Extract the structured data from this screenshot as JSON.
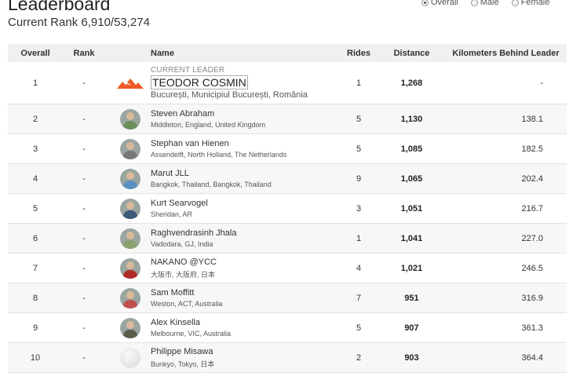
{
  "header": {
    "title": "Leaderboard",
    "current_rank": "Current Rank 6,910/53,274"
  },
  "filters": [
    {
      "label": "Overall",
      "selected": true
    },
    {
      "label": "Male",
      "selected": false
    },
    {
      "label": "Female",
      "selected": false
    }
  ],
  "table": {
    "columns": {
      "overall": "Overall",
      "rank": "Rank",
      "name": "Name",
      "rides": "Rides",
      "distance": "Distance",
      "behind": "Kilometers Behind Leader"
    },
    "leader": {
      "badge": "CURRENT LEADER",
      "overall": "1",
      "rank": "-",
      "name": "TEODOR COSMIN",
      "location": "București, Municipiul București, România",
      "rides": "1",
      "distance": "1,268",
      "behind": "-",
      "logo_color": "#f05a28"
    },
    "rows": [
      {
        "overall": "2",
        "rank": "-",
        "name": "Steven Abraham",
        "location": "Middleton, England, United Kingdom",
        "rides": "5",
        "distance": "1,130",
        "behind": "138.1",
        "avatar_color": "#6b8f5a"
      },
      {
        "overall": "3",
        "rank": "-",
        "name": "Stephan van Hienen",
        "location": "Assendelft, North Holland, The Netherlands",
        "rides": "5",
        "distance": "1,085",
        "behind": "182.5",
        "avatar_color": "#777777"
      },
      {
        "overall": "4",
        "rank": "-",
        "name": "Marut JLL",
        "location": "Bangkok, Thailand, Bangkok, Thailand",
        "rides": "9",
        "distance": "1,065",
        "behind": "202.4",
        "avatar_color": "#5a8fc0"
      },
      {
        "overall": "5",
        "rank": "-",
        "name": "Kurt Searvogel",
        "location": "Sheridan, AR",
        "rides": "3",
        "distance": "1,051",
        "behind": "216.7",
        "avatar_color": "#3d5a7a"
      },
      {
        "overall": "6",
        "rank": "-",
        "name": "Raghvendrasinh Jhala",
        "location": "Vadodara, GJ, India",
        "rides": "1",
        "distance": "1,041",
        "behind": "227.0",
        "avatar_color": "#8aa070"
      },
      {
        "overall": "7",
        "rank": "-",
        "name": "NAKANO @YCC",
        "location": "大阪市, 大阪府, 日本",
        "rides": "4",
        "distance": "1,021",
        "behind": "246.5",
        "avatar_color": "#b22b2b"
      },
      {
        "overall": "8",
        "rank": "-",
        "name": "Sam Moffitt",
        "location": "Weston, ACT, Australia",
        "rides": "7",
        "distance": "951",
        "behind": "316.9",
        "avatar_color": "#c0504d"
      },
      {
        "overall": "9",
        "rank": "-",
        "name": "Alex Kinsella",
        "location": "Melbourne, VIC, Australia",
        "rides": "5",
        "distance": "907",
        "behind": "361.3",
        "avatar_color": "#5c5c4a"
      },
      {
        "overall": "10",
        "rank": "-",
        "name": "Philippe Misawa",
        "location": "Bunkyo, Tokyo, 日本",
        "rides": "2",
        "distance": "903",
        "behind": "364.4",
        "avatar_color": "#dddddd"
      }
    ]
  }
}
